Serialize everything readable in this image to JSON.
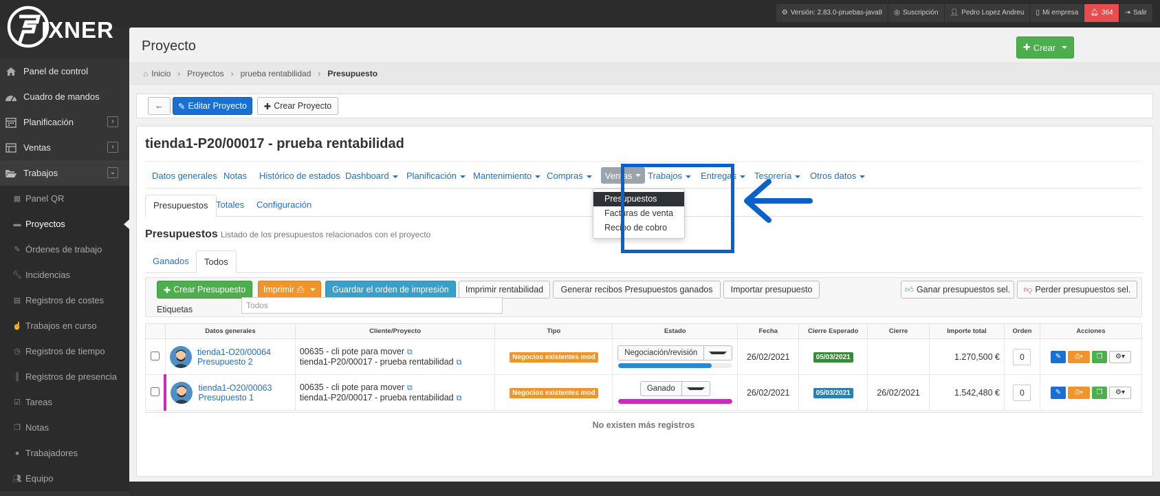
{
  "topbar": {
    "version": "Versión: 2.83.0-pruebas-java8",
    "subscription": "Suscripción",
    "user": "Pedro Lopez Andreu",
    "company": "Mi empresa",
    "notifications": "364",
    "logout": "Salir"
  },
  "logo": {
    "text": "FIXNER"
  },
  "sidebar": {
    "items": [
      {
        "label": "Panel de control",
        "icon": "home-icon"
      },
      {
        "label": "Cuadro de mandos",
        "icon": "dashboard-icon"
      },
      {
        "label": "Planificación",
        "icon": "calendar-icon"
      },
      {
        "label": "Ventas",
        "icon": "ventas-icon"
      },
      {
        "label": "Trabajos",
        "icon": "folder-open-icon"
      }
    ],
    "subitems": [
      {
        "label": "Panel QR",
        "icon": "grid-icon"
      },
      {
        "label": "Proyectos",
        "icon": "briefcase-icon"
      },
      {
        "label": "Órdenes de trabajo",
        "icon": "edit-icon"
      },
      {
        "label": "Incidencias",
        "icon": "wrench-icon"
      },
      {
        "label": "Registros de costes",
        "icon": "table-icon"
      },
      {
        "label": "Trabajos en curso",
        "icon": "hand-icon"
      },
      {
        "label": "Registros de tiempo",
        "icon": "clock-icon"
      },
      {
        "label": "Registros de presencia",
        "icon": "barcode-icon"
      },
      {
        "label": "Tareas",
        "icon": "check-icon"
      },
      {
        "label": "Notas",
        "icon": "copy-icon"
      },
      {
        "label": "Trabajadores",
        "icon": "user-icon"
      },
      {
        "label": "Equipo",
        "icon": "users-icon"
      }
    ]
  },
  "page": {
    "title": "Proyecto",
    "create_label": "Crear",
    "breadcrumb": [
      "Inicio",
      "Proyectos",
      "prueba rentabilidad",
      "Presupuesto"
    ]
  },
  "toolbar": {
    "back": "←",
    "edit": "Editar Proyecto",
    "create": "Crear Proyecto"
  },
  "project": {
    "title": "tienda1-P20/00017 - prueba rentabilidad",
    "tabs": [
      "Datos generales",
      "Notas",
      "Histórico de estados",
      "Dashboard",
      "Planificación",
      "Mantenimiento",
      "Compras",
      "Ventas",
      "Trabajos",
      "Entregas",
      "Tesorería",
      "Otros datos"
    ],
    "dropdown": [
      "Presupuestos",
      "Facturas de venta",
      "Recibo de cobro"
    ]
  },
  "subtabs": [
    "Presupuestos",
    "Totales",
    "Configuración"
  ],
  "section": {
    "title": "Presupuestos",
    "subtitle": "Listado de los presupuestos relacionados con el proyecto",
    "filters": [
      "Ganados",
      "Todos"
    ]
  },
  "actions": {
    "crear": "Crear Presupuesto",
    "imprimir": "Imprimir",
    "guardar": "Guardar el orden de impresión",
    "rentabilidad": "Imprimir rentabilidad",
    "recibos": "Generar recibos Presupuestos ganados",
    "importar": "Importar presupuesto",
    "ganar": "Ganar presupuestos sel.",
    "perder": "Perder presupuestos sel.",
    "etiquetas_label": "Etiquetas",
    "etiquetas_placeholder": "Todos"
  },
  "table": {
    "headers": [
      "Datos generales",
      "Cliente/Proyecto",
      "Tipo",
      "Estado",
      "Fecha",
      "Cierre Esperado",
      "Cierre",
      "Importe total",
      "Orden",
      "Acciones"
    ],
    "rows": [
      {
        "code": "tienda1-O20/00064",
        "name": "Presupuesto 2",
        "client": "00635 - cli pote para mover",
        "project": "tienda1-P20/00017 - prueba rentabilidad",
        "tipo": "Negocios existentes mod",
        "estado": "Negociación/revisión",
        "progress": 0.82,
        "progress_color": "#2a8ad1",
        "fecha": "26/02/2021",
        "cierre_esperado": "05/03/2021",
        "cierre": "",
        "importe": "1.270,500 €",
        "orden": "0"
      },
      {
        "code": "tienda1-O20/00063",
        "name": "Presupuesto 1",
        "client": "00635 - cli pote para mover",
        "project": "tienda1-P20/00017 - prueba rentabilidad",
        "tipo": "Negocios existentes mod",
        "estado": "Ganado",
        "progress": 1.0,
        "progress_color": "#c92cb8",
        "fecha": "26/02/2021",
        "cierre_esperado": "05/03/2021",
        "cierre": "26/02/2021",
        "importe": "1.542,480 €",
        "orden": "0"
      }
    ],
    "footer": "No existen más registros"
  }
}
